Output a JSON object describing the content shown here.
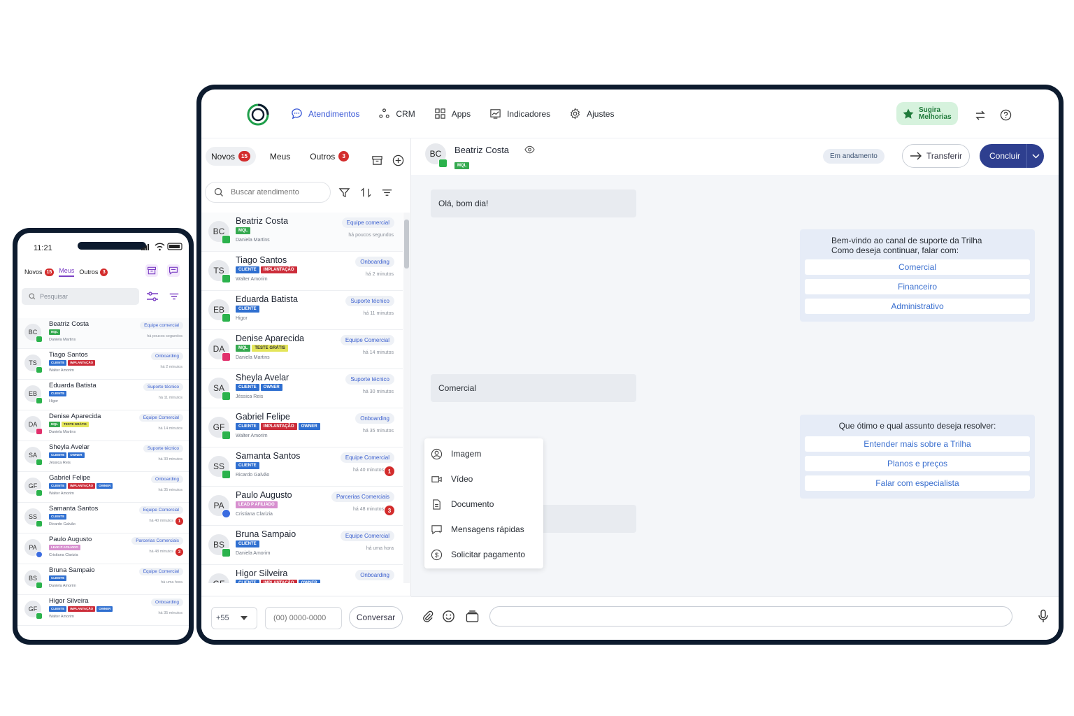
{
  "colors": {
    "accent": "#3857d6",
    "brand_green": "#2bb24c",
    "badge_red": "#d32c2c",
    "primary_button": "#2e3f8f",
    "purple": "#7b3fc4"
  },
  "nav": {
    "items": [
      {
        "label": "Atendimentos",
        "icon": "chat-bubble-icon",
        "active": true
      },
      {
        "label": "CRM",
        "icon": "crm-nodes-icon"
      },
      {
        "label": "Apps",
        "icon": "apps-grid-icon"
      },
      {
        "label": "Indicadores",
        "icon": "chart-icon"
      },
      {
        "label": "Ajustes",
        "icon": "gear-icon"
      }
    ],
    "suggest_line1": "Sugira",
    "suggest_line2": "Melhorias"
  },
  "tabs": {
    "novos": "Novos",
    "novos_count": "15",
    "meus": "Meus",
    "outros": "Outros",
    "outros_count": "3"
  },
  "search": {
    "placeholder": "Buscar atendimento"
  },
  "conversations": [
    {
      "initials": "BC",
      "name": "Beatriz Costa",
      "tags": [
        {
          "t": "MQL",
          "c": "mql"
        }
      ],
      "agent": "Daniela Martins",
      "team": "Equipe comercial",
      "time": "há poucos segundos",
      "channel": "whatsapp",
      "badge": ""
    },
    {
      "initials": "TS",
      "name": "Tiago Santos",
      "tags": [
        {
          "t": "CLIENTE",
          "c": "cliente"
        },
        {
          "t": "IMPLANTAÇÃO",
          "c": "impl"
        }
      ],
      "agent": "Walter Amorim",
      "team": "Onboarding",
      "time": "há 2 minutos",
      "channel": "whatsapp",
      "badge": ""
    },
    {
      "initials": "EB",
      "name": "Eduarda Batista",
      "tags": [
        {
          "t": "CLIENTE",
          "c": "cliente"
        }
      ],
      "agent": "Higor",
      "team": "Suporte técnico",
      "time": "há 11 minutos",
      "channel": "whatsapp",
      "badge": ""
    },
    {
      "initials": "DA",
      "name": "Denise Aparecida",
      "tags": [
        {
          "t": "MQL",
          "c": "mql"
        },
        {
          "t": "TESTE GRÁTIS",
          "c": "teste"
        }
      ],
      "agent": "Daniela Martins",
      "team": "Equipe Comercial",
      "time": "há 14 minutos",
      "channel": "instagram",
      "badge": ""
    },
    {
      "initials": "SA",
      "name": "Sheyla Avelar",
      "tags": [
        {
          "t": "CLIENTE",
          "c": "cliente"
        },
        {
          "t": "OWNER",
          "c": "owner"
        }
      ],
      "agent": "Jéssica Reis",
      "team": "Suporte técnico",
      "time": "há 30 minutos",
      "channel": "whatsapp",
      "badge": ""
    },
    {
      "initials": "GF",
      "name": "Gabriel Felipe",
      "tags": [
        {
          "t": "CLIENTE",
          "c": "cliente"
        },
        {
          "t": "IMPLANTAÇÃO",
          "c": "impl"
        },
        {
          "t": "OWNER",
          "c": "owner"
        }
      ],
      "agent": "Walter Amorim",
      "team": "Onboarding",
      "time": "há 35 minutos",
      "channel": "whatsapp",
      "badge": ""
    },
    {
      "initials": "SS",
      "name": "Samanta Santos",
      "tags": [
        {
          "t": "CLIENTE",
          "c": "cliente"
        }
      ],
      "agent": "Ricardo Galvão",
      "team": "Equipe Comercial",
      "time": "há 40 minutos",
      "channel": "whatsapp",
      "badge": "1"
    },
    {
      "initials": "PA",
      "name": "Paulo Augusto",
      "tags": [
        {
          "t": "LEAD P AFILIADO",
          "c": "lead"
        }
      ],
      "agent": "Cristiana Clarizia",
      "team": "Parcerias Comerciais",
      "time": "há 48 minutos",
      "channel": "messenger",
      "badge": "3"
    },
    {
      "initials": "BS",
      "name": "Bruna Sampaio",
      "tags": [
        {
          "t": "CLIENTE",
          "c": "cliente"
        }
      ],
      "agent": "Daniela Amorim",
      "team": "Equipe Comercial",
      "time": "há uma hora",
      "channel": "whatsapp",
      "badge": ""
    },
    {
      "initials": "GF",
      "name": "Higor Silveira",
      "tags": [
        {
          "t": "CLIENTE",
          "c": "cliente"
        },
        {
          "t": "IMPLANTAÇÃO",
          "c": "impl"
        },
        {
          "t": "OWNER",
          "c": "owner"
        }
      ],
      "agent": "Walter Amorim",
      "team": "Onboarding",
      "time": "há 35 minutos",
      "channel": "whatsapp",
      "badge": ""
    }
  ],
  "footer": {
    "ddi": "+55",
    "phone_placeholder": "(00) 0000-0000",
    "talk_label": "Conversar"
  },
  "chat": {
    "initials": "BC",
    "name": "Beatriz Costa",
    "tag": "MQL",
    "status": "Em andamento",
    "transfer_label": "Transferir",
    "conclude_label": "Concluir",
    "messages": [
      "Olá, bom dia!",
      "Comercial"
    ],
    "card1_line1": "Bem-vindo ao canal de suporte da Trilha",
    "card1_line2": "Como deseja continuar, falar com:",
    "card1_options": [
      "Comercial",
      "Financeiro",
      "Administrativo"
    ],
    "card2_head": "Que ótimo e qual assunto deseja resolver:",
    "card2_options": [
      "Entender mais sobre a Trilha",
      "Planos e preços",
      "Falar com especialista"
    ]
  },
  "attach_menu": [
    {
      "label": "Imagem",
      "icon": "user-circle-icon"
    },
    {
      "label": "Vídeo",
      "icon": "video-icon"
    },
    {
      "label": "Documento",
      "icon": "document-icon"
    },
    {
      "label": "Mensagens rápidas",
      "icon": "quick-message-icon"
    },
    {
      "label": "Solicitar pagamento",
      "icon": "dollar-icon"
    }
  ],
  "phone": {
    "time": "11:21",
    "tabs": {
      "novos": "Novos",
      "novos_count": "15",
      "meus": "Meus",
      "outros": "Outros",
      "outros_count": "3"
    },
    "search_placeholder": "Pesquisar"
  }
}
